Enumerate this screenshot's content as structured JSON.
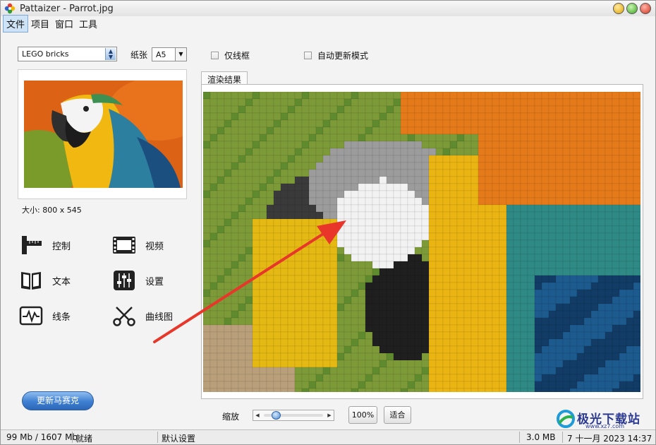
{
  "window": {
    "title": "Pattaizer - Parrot.jpg"
  },
  "menu": [
    "文件",
    "项目",
    "窗口",
    "工具"
  ],
  "controls": {
    "mosaic_type": "LEGO bricks",
    "paper_label": "纸张",
    "paper_value": "A5",
    "wireframe_label": "仅线框",
    "auto_update_label": "自动更新模式"
  },
  "thumbnail": {
    "size_text": "大小: 800 x 545"
  },
  "tools": [
    {
      "label": "控制",
      "icon": "ruler-icon"
    },
    {
      "label": "视频",
      "icon": "film-icon"
    },
    {
      "label": "文本",
      "icon": "book-icon"
    },
    {
      "label": "设置",
      "icon": "sliders-icon"
    },
    {
      "label": "线条",
      "icon": "waveform-icon"
    },
    {
      "label": "曲线图",
      "icon": "scissors-icon"
    }
  ],
  "update_button": "更新马赛克",
  "render": {
    "tab_label": "渲染结果"
  },
  "zoom": {
    "label": "缩放",
    "btn_100": "100%",
    "btn_fit": "适合"
  },
  "status": {
    "memory": "99 Mb / 1607 Mb",
    "state": "就绪",
    "preset": "默认设置",
    "filesize": "3.0 MB",
    "datetime": "7 十一月 2023   14:37"
  },
  "watermark": {
    "text": "极光下载站",
    "url": "www.xz7.com"
  },
  "colors": {
    "accent": "#3e7fd1",
    "arrow": "#e8372a"
  }
}
